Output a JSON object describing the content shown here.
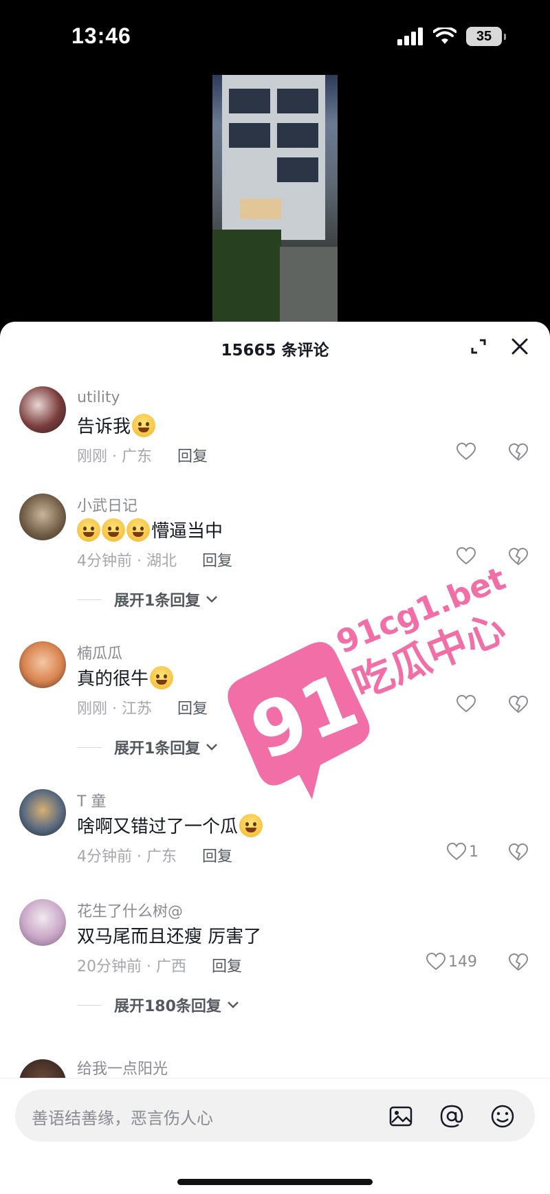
{
  "status": {
    "time": "13:46",
    "battery": "35"
  },
  "sheet": {
    "title": "15665 条评论",
    "input_placeholder": "善语结善缘，恶言伤人心"
  },
  "comments": [
    {
      "user": "utility",
      "text": "告诉我",
      "time_loc": "刚刚 · 广东",
      "reply": "回复",
      "likes": ""
    },
    {
      "user": "小武日记",
      "text": "懵逼当中",
      "time_loc": "4分钟前 · 湖北",
      "reply": "回复",
      "likes": "",
      "expand": "展开1条回复"
    },
    {
      "user": "楠瓜瓜",
      "text": "真的很牛",
      "time_loc": "刚刚 · 江苏",
      "reply": "回复",
      "likes": "",
      "expand": "展开1条回复"
    },
    {
      "user": "T  童",
      "text": "啥啊又错过了一个瓜",
      "time_loc": "4分钟前 · 广东",
      "reply": "回复",
      "likes": "1"
    },
    {
      "user": "花生了什么树@",
      "text": "双马尾而且还瘦 厉害了",
      "time_loc": "20分钟前 · 广西",
      "reply": "回复",
      "likes": "149",
      "expand": "展开180条回复"
    },
    {
      "user": "给我一点阳光"
    }
  ],
  "watermark": {
    "number": "91",
    "site": "91cg1.bet",
    "name": "吃瓜中心",
    "color": "#f26ea6"
  }
}
